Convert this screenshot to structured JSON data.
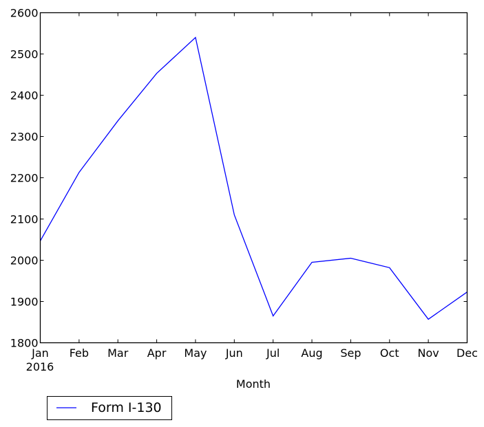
{
  "chart_data": {
    "type": "line",
    "title": "",
    "xlabel": "Month",
    "ylabel": "",
    "categories": [
      "Jan",
      "Feb",
      "Mar",
      "Apr",
      "May",
      "Jun",
      "Jul",
      "Aug",
      "Sep",
      "Oct",
      "Nov",
      "Dec"
    ],
    "x_sublabel": "2016",
    "yticks": [
      1800,
      1900,
      2000,
      2100,
      2200,
      2300,
      2400,
      2500,
      2600
    ],
    "ylim": [
      1800,
      2600
    ],
    "grid": false,
    "legend_position": "below-left",
    "series": [
      {
        "name": "Form I-130",
        "color": "#0000ff",
        "values": [
          2047,
          2213,
          2338,
          2453,
          2540,
          2110,
          1865,
          1995,
          2005,
          1982,
          1857,
          1923
        ]
      }
    ]
  }
}
